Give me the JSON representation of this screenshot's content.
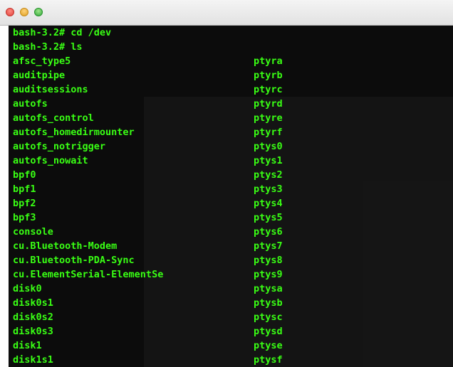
{
  "terminal": {
    "prompt_lines": [
      "bash-3.2# cd /dev",
      "bash-3.2# ls"
    ],
    "listing": [
      [
        "afsc_type5",
        "ptyra"
      ],
      [
        "auditpipe",
        "ptyrb"
      ],
      [
        "auditsessions",
        "ptyrc"
      ],
      [
        "autofs",
        "ptyrd"
      ],
      [
        "autofs_control",
        "ptyre"
      ],
      [
        "autofs_homedirmounter",
        "ptyrf"
      ],
      [
        "autofs_notrigger",
        "ptys0"
      ],
      [
        "autofs_nowait",
        "ptys1"
      ],
      [
        "bpf0",
        "ptys2"
      ],
      [
        "bpf1",
        "ptys3"
      ],
      [
        "bpf2",
        "ptys4"
      ],
      [
        "bpf3",
        "ptys5"
      ],
      [
        "console",
        "ptys6"
      ],
      [
        "cu.Bluetooth-Modem",
        "ptys7"
      ],
      [
        "cu.Bluetooth-PDA-Sync",
        "ptys8"
      ],
      [
        "cu.ElementSerial-ElementSe",
        "ptys9"
      ],
      [
        "disk0",
        "ptysa"
      ],
      [
        "disk0s1",
        "ptysb"
      ],
      [
        "disk0s2",
        "ptysc"
      ],
      [
        "disk0s3",
        "ptysd"
      ],
      [
        "disk1",
        "ptyse"
      ],
      [
        "disk1s1",
        "ptysf"
      ]
    ],
    "text_color": "#39ff14",
    "background_color": "#0c0c0c"
  }
}
